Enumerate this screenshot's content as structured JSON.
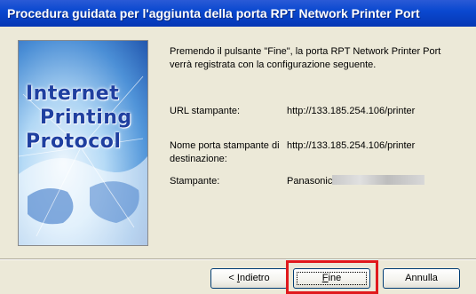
{
  "window": {
    "title": "Procedura guidata per l'aggiunta della porta RPT Network Printer Port"
  },
  "side_image": {
    "line1": "Internet",
    "line2": "Printing",
    "line3": "Protocol"
  },
  "content": {
    "intro": "Premendo il pulsante \"Fine\", la porta RPT Network Printer Port verrà registrata con la configurazione seguente.",
    "url_label": "URL stampante:",
    "url_value": "http://133.185.254.106/printer",
    "dest_label": "Nome porta stampante di destinazione:",
    "dest_value": "http://133.185.254.106/printer",
    "printer_label": "Stampante:",
    "printer_value": "Panasonic"
  },
  "buttons": {
    "back_prefix": "< ",
    "back_accel": "I",
    "back_rest": "ndietro",
    "finish_accel": "F",
    "finish_rest": "ine",
    "cancel": "Annulla"
  },
  "colors": {
    "titlebar": "#0a49d0",
    "highlight_box": "#e0191c"
  }
}
